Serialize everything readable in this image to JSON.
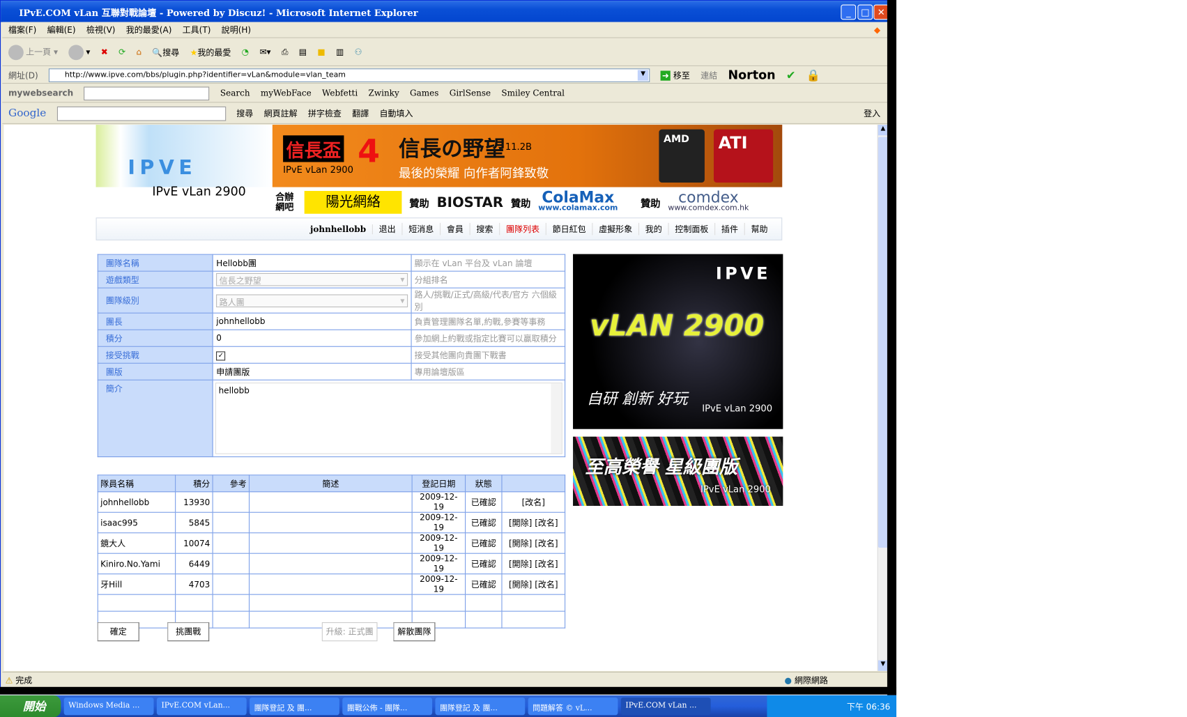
{
  "window": {
    "title": "IPvE.COM vLan 互聯對戰論壇 - Powered by Discuz! - Microsoft Internet Explorer"
  },
  "menu": [
    "檔案(F)",
    "編輯(E)",
    "檢視(V)",
    "我的最愛(A)",
    "工具(T)",
    "說明(H)"
  ],
  "toolbar": {
    "back": "上一頁",
    "search": "搜尋",
    "favorites": "我的最愛"
  },
  "address": {
    "label": "網址(D)",
    "url": "http://www.ipve.com/bbs/plugin.php?identifier=vLan&module=vlan_team",
    "go": "移至",
    "links": "連結",
    "norton": "Norton"
  },
  "mywebsearch": {
    "brand": "mywebsearch",
    "search": "Search",
    "items": [
      "myWebFace",
      "Webfetti",
      "Zwinky",
      "Games",
      "GirlSense",
      "Smiley Central"
    ]
  },
  "google": {
    "brand": "Google",
    "items": [
      "搜尋",
      "網頁註解",
      "拼字檢查",
      "翻譯",
      "自動填入"
    ],
    "login": "登入"
  },
  "site": {
    "logo_caption": "IPvE vLan 2900",
    "banner": {
      "cup": "信長盃",
      "num": "4",
      "game": "信長の野望",
      "ver": "11.2B",
      "slogan": "最後的榮耀 向作者阿鋒致敬",
      "sub": "IPvE vLan 2900"
    },
    "sponsors": {
      "cafe_label": "合辦網吧",
      "cafe": "陽光網絡",
      "sponsor_label": "贊助",
      "biostar": "BIOSTAR",
      "colamax": "ColaMax",
      "colamax_url": "www.colamax.com",
      "comdex": "comdex",
      "comdex_url": "www.comdex.com.hk"
    },
    "nav": {
      "user": "johnhellobb",
      "items": [
        "退出",
        "短消息",
        "會員",
        "搜索",
        "團隊列表",
        "節日紅包",
        "虛擬形象",
        "我的",
        "控制面板",
        "插件",
        "幫助"
      ]
    },
    "side1": {
      "slogan": "自研 創新 好玩",
      "caption": "IPvE vLan 2900",
      "title": "vLAN 2900"
    },
    "side2": {
      "slogan": "至高榮譽 星級團版",
      "caption": "IPvE vLan 2900"
    }
  },
  "form": [
    {
      "label": "團隊名稱",
      "value": "Hellobb團",
      "hint": "顯示在 vLan 平台及 vLan 論壇",
      "type": "text"
    },
    {
      "label": "遊戲類型",
      "value": "信長之野望",
      "hint": "分組排名",
      "type": "select"
    },
    {
      "label": "團隊級別",
      "value": "路人團",
      "hint": "路人/挑戰/正式/高級/代表/官方 六個級別",
      "type": "select"
    },
    {
      "label": "團長",
      "value": "johnhellobb",
      "hint": "負責管理團隊名單,約戰,參賽等事務",
      "type": "text"
    },
    {
      "label": "積分",
      "value": "0",
      "hint": "參加網上約戰或指定比賽可以贏取積分",
      "type": "text"
    },
    {
      "label": "接受挑戰",
      "value": "✓",
      "hint": "接受其他團向貴團下戰書",
      "type": "check"
    },
    {
      "label": "團版",
      "value": "申請團版",
      "hint": "專用論壇版區",
      "type": "text"
    }
  ],
  "intro": {
    "label": "簡介",
    "value": "hellobb"
  },
  "members": {
    "headers": [
      "隊員名稱",
      "積分",
      "參考",
      "簡述",
      "登記日期",
      "狀態",
      ""
    ],
    "rows": [
      {
        "name": "johnhellobb",
        "score": "13930",
        "date": "2009-12-19",
        "status": "已確認",
        "kick": "",
        "rename": "[改名]"
      },
      {
        "name": "isaac995",
        "score": "5845",
        "date": "2009-12-19",
        "status": "已確認",
        "kick": "[開除]",
        "rename": "[改名]"
      },
      {
        "name": "鏡大人",
        "score": "10074",
        "date": "2009-12-19",
        "status": "已確認",
        "kick": "[開除]",
        "rename": "[改名]"
      },
      {
        "name": "Kiniro.No.Yami",
        "score": "6449",
        "date": "2009-12-19",
        "status": "已確認",
        "kick": "[開除]",
        "rename": "[改名]"
      },
      {
        "name": "牙Hill",
        "score": "4703",
        "date": "2009-12-19",
        "status": "已確認",
        "kick": "[開除]",
        "rename": "[改名]"
      }
    ]
  },
  "buttons": {
    "confirm": "確定",
    "challenge": "挑團戰",
    "upgrade": "升級: 正式團",
    "disband": "解散團隊"
  },
  "status": {
    "text": "完成",
    "zone": "網際網路"
  },
  "taskbar": {
    "start": "開始",
    "tasks": [
      "Windows Media ...",
      "IPvE.COM vLan...",
      "團隊登記 及 團...",
      "團戰公佈 - 團隊...",
      "團隊登記 及 團...",
      "問題解答 © vL...",
      "IPvE.COM vLan ..."
    ],
    "clock": "下午 06:36"
  }
}
